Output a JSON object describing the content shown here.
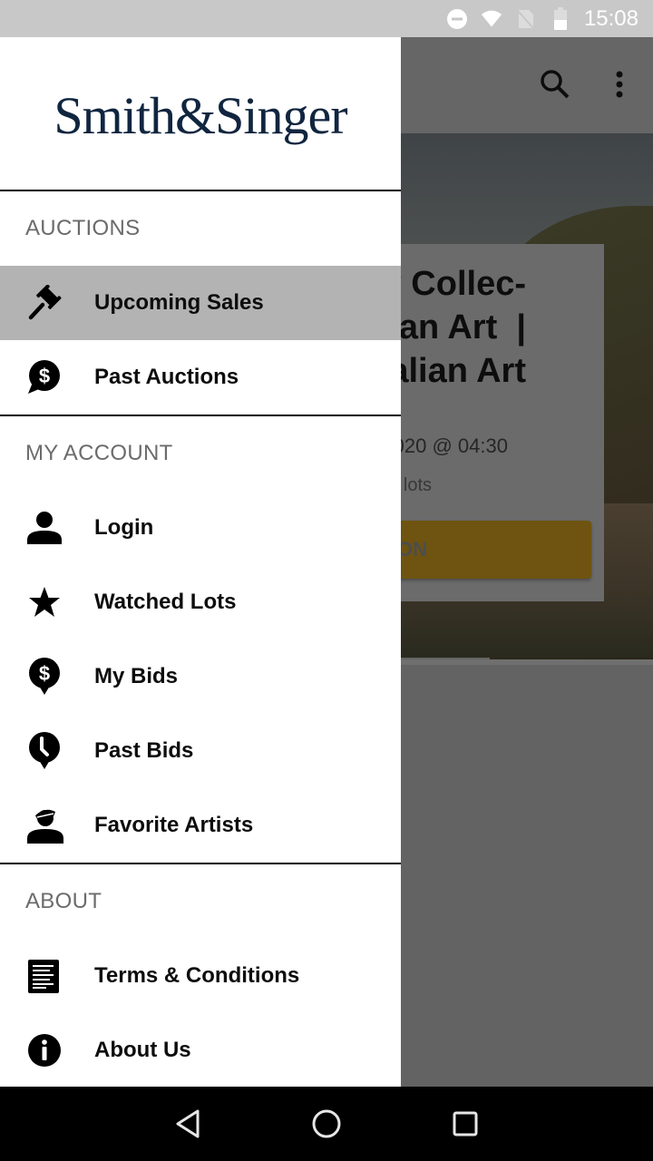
{
  "status_bar": {
    "time": "15:08",
    "icons": [
      "do-not-disturb-icon",
      "wifi-icon",
      "no-sim-icon",
      "battery-icon"
    ]
  },
  "background_app": {
    "toolbar_icons": [
      "search-icon",
      "more-vert-icon"
    ],
    "sale_card": {
      "title_visible": "y Collec-\nan Art  |\nalian Art",
      "date_visible": "020 @ 04:30",
      "lots_visible": "lots",
      "button_visible": "ON"
    }
  },
  "drawer": {
    "logo": "Smith&Singer",
    "sections": [
      {
        "title": "AUCTIONS",
        "items": [
          {
            "label": "Upcoming Sales",
            "icon": "gavel-icon",
            "active": true
          },
          {
            "label": "Past Auctions",
            "icon": "dollar-chat-icon",
            "active": false
          }
        ]
      },
      {
        "title": "MY ACCOUNT",
        "items": [
          {
            "label": "Login",
            "icon": "person-icon",
            "active": false
          },
          {
            "label": "Watched Lots",
            "icon": "star-icon",
            "active": false
          },
          {
            "label": "My Bids",
            "icon": "dollar-pin-icon",
            "active": false
          },
          {
            "label": "Past Bids",
            "icon": "clock-pin-icon",
            "active": false
          },
          {
            "label": "Favorite Artists",
            "icon": "artist-icon",
            "active": false
          }
        ]
      },
      {
        "title": "ABOUT",
        "items": [
          {
            "label": "Terms & Conditions",
            "icon": "document-icon",
            "active": false
          },
          {
            "label": "About Us",
            "icon": "info-icon",
            "active": false
          }
        ]
      }
    ]
  },
  "nav_bar": {
    "buttons": [
      "back-icon",
      "home-icon",
      "recents-icon"
    ]
  },
  "colors": {
    "logo": "#10253f",
    "active_item_bg": "#b3b3b3",
    "section_title": "#6b6b6b",
    "scrim": "#636363"
  }
}
